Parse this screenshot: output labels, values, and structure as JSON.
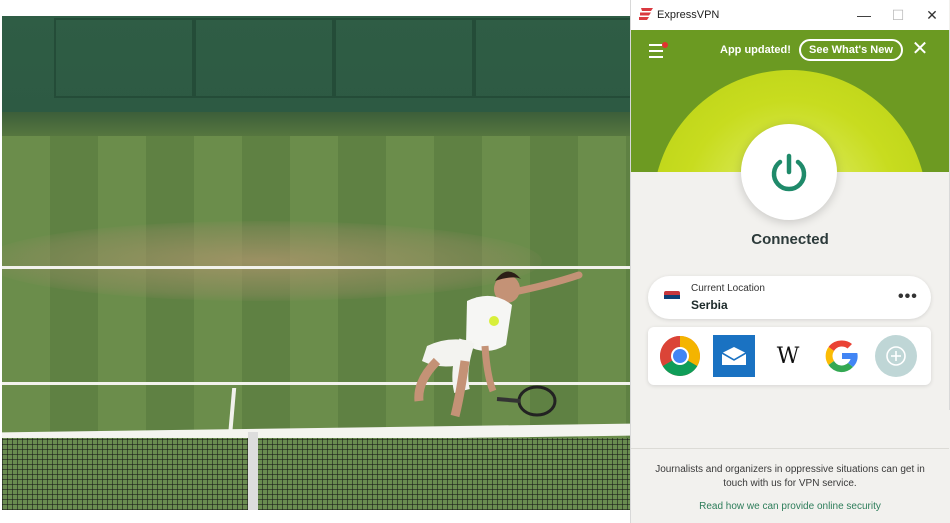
{
  "window": {
    "title": "ExpressVPN",
    "minimize_glyph": "—",
    "maximize_glyph": "☐",
    "close_glyph": "✕"
  },
  "banner": {
    "message": "App updated!",
    "button_label": "See What's New",
    "close_glyph": "✕"
  },
  "connection": {
    "status": "Connected"
  },
  "location": {
    "label": "Current Location",
    "value": "Serbia",
    "more_glyph": "•••"
  },
  "shortcuts": {
    "wikipedia_glyph": "W"
  },
  "footer": {
    "text": "Journalists and organizers in oppressive situations can get in touch with us for VPN service.",
    "link": "Read how we can provide online security"
  },
  "colors": {
    "brand_green": "#6b9a22",
    "accent_teal": "#1f8a6a",
    "link_green": "#2d7d5a"
  },
  "icons": [
    "expressvpn-logo",
    "menu-icon",
    "power-icon",
    "serbia-flag-icon",
    "chrome-icon",
    "mail-icon",
    "wikipedia-icon",
    "google-icon",
    "add-shortcut-icon"
  ]
}
